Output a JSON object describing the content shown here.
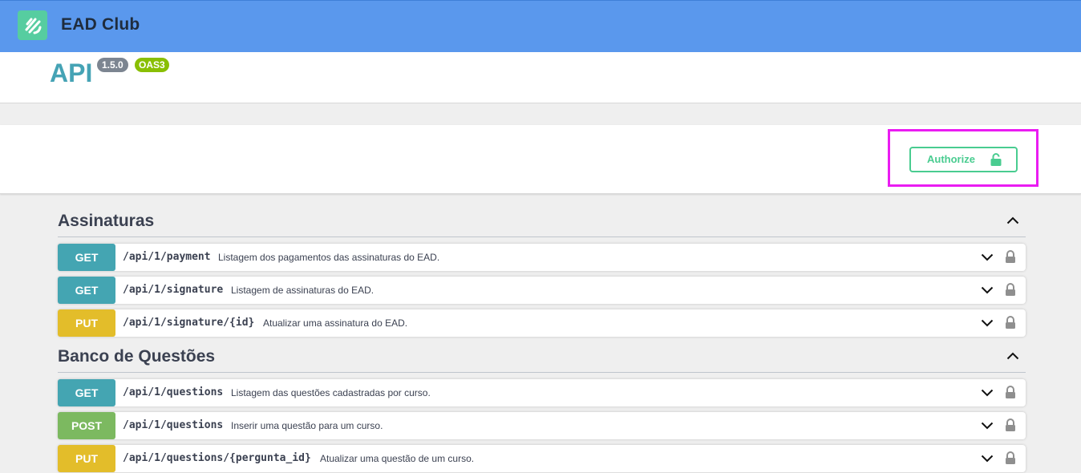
{
  "header": {
    "brand": "EAD Club"
  },
  "info": {
    "title": "API",
    "version": "1.5.0",
    "oas": "OAS3"
  },
  "authorize": {
    "label": "Authorize"
  },
  "colors": {
    "get": "#44a5b2",
    "put": "#e3bd2a",
    "post": "#7cb960",
    "authorize": "#49cc90",
    "topbar": "#5a98ed"
  },
  "sections": [
    {
      "title": "Assinaturas",
      "ops": [
        {
          "method": "GET",
          "path": "/api/1/payment",
          "description": "Listagem dos pagamentos das assinaturas do EAD."
        },
        {
          "method": "GET",
          "path": "/api/1/signature",
          "description": "Listagem de assinaturas do EAD."
        },
        {
          "method": "PUT",
          "path": "/api/1/signature/{id}",
          "description": "Atualizar uma assinatura do EAD."
        }
      ]
    },
    {
      "title": "Banco de Questões",
      "ops": [
        {
          "method": "GET",
          "path": "/api/1/questions",
          "description": "Listagem das questões cadastradas por curso."
        },
        {
          "method": "POST",
          "path": "/api/1/questions",
          "description": "Inserir uma questão para um curso."
        },
        {
          "method": "PUT",
          "path": "/api/1/questions/{pergunta_id}",
          "description": "Atualizar uma questão de um curso."
        }
      ]
    }
  ]
}
